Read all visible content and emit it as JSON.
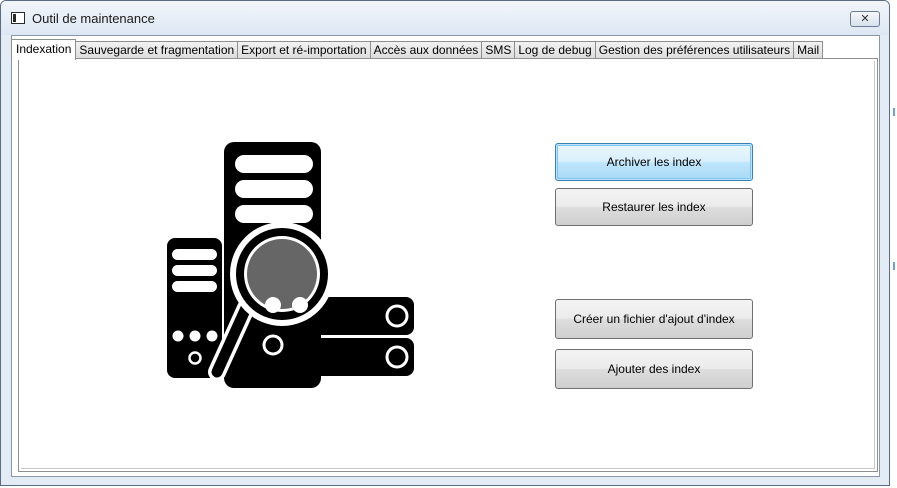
{
  "window": {
    "title": "Outil de maintenance",
    "close_glyph": "✕"
  },
  "tabs": [
    {
      "label": "Indexation",
      "active": true
    },
    {
      "label": "Sauvegarde et fragmentation",
      "active": false
    },
    {
      "label": "Export et ré-importation",
      "active": false
    },
    {
      "label": "Accès aux données",
      "active": false
    },
    {
      "label": "SMS",
      "active": false
    },
    {
      "label": "Log de debug",
      "active": false
    },
    {
      "label": "Gestion des préférences utilisateurs",
      "active": false
    },
    {
      "label": "Mail",
      "active": false
    }
  ],
  "panel": {
    "illustration_icon": "server-search-icon",
    "buttons": {
      "archive": "Archiver les index",
      "restore": "Restaurer les index",
      "create": "Créer un fichier d'ajout d'index",
      "add": "Ajouter des index"
    }
  },
  "colors": {
    "focus_border": "#3c7fb1",
    "icon_fill": "#000000",
    "lens_fill": "#666666"
  }
}
